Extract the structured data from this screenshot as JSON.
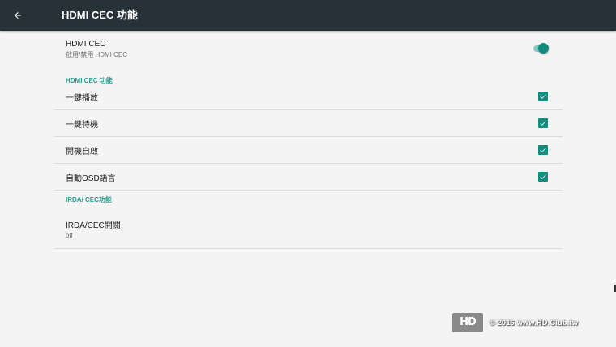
{
  "appbar": {
    "back_icon": "arrow-back-icon",
    "title": "HDMI CEC 功能"
  },
  "master": {
    "title": "HDMI CEC",
    "subtitle": "啟用/禁用 HDMI CEC",
    "toggle_on": true
  },
  "sections": [
    {
      "header": "HDMI CEC 功能",
      "items": [
        {
          "label": "一鍵播放",
          "checked": true
        },
        {
          "label": "一鍵待機",
          "checked": true
        },
        {
          "label": "開機自啟",
          "checked": true
        },
        {
          "label": "自動OSD語言",
          "checked": true
        }
      ]
    },
    {
      "header": "IRDA/ CEC功能",
      "items": [
        {
          "label": "IRDA/CEC開關",
          "summary": "off"
        }
      ]
    }
  ],
  "watermark": {
    "logo": "HD",
    "text": "© 2016  www.HD.Club.tw"
  },
  "colors": {
    "appbar": "#263238",
    "accent": "#128c7e",
    "category": "#2a9d8f",
    "background": "#f4f4f4"
  }
}
